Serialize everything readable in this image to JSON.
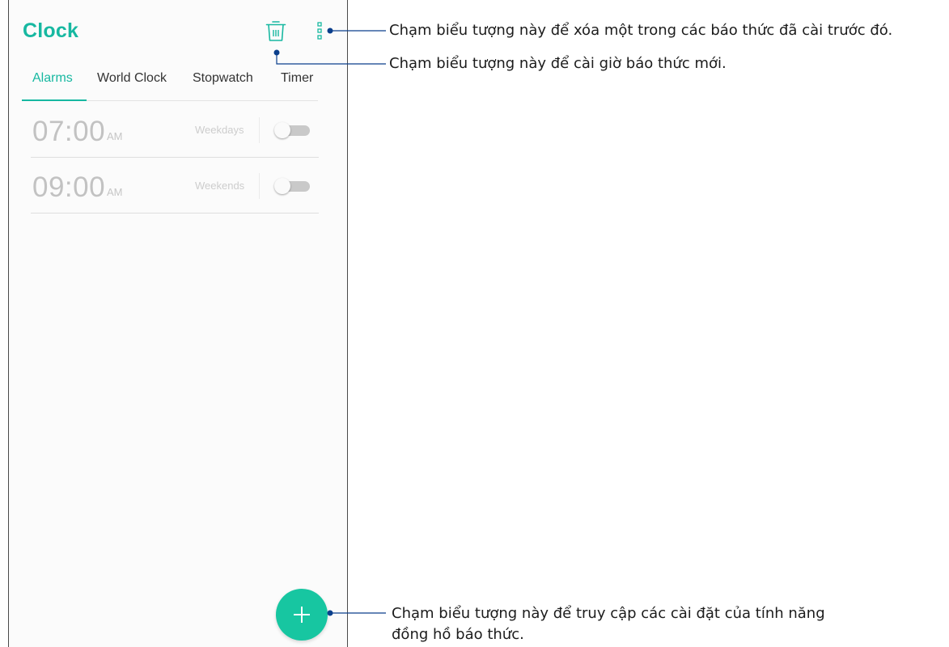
{
  "app": {
    "title": "Clock",
    "accent_color": "#17b8a1",
    "icons": {
      "delete": "trash-icon",
      "menu": "overflow-menu-icon",
      "add": "plus-icon"
    }
  },
  "tabs": [
    {
      "label": "Alarms",
      "active": true
    },
    {
      "label": "World Clock",
      "active": false
    },
    {
      "label": "Stopwatch",
      "active": false
    },
    {
      "label": "Timer",
      "active": false
    }
  ],
  "alarms": [
    {
      "time": "07:00",
      "ampm": "AM",
      "days": "Weekdays",
      "enabled": false
    },
    {
      "time": "09:00",
      "ampm": "AM",
      "days": "Weekends",
      "enabled": false
    }
  ],
  "annotations": {
    "menu_callout": "Chạm biểu tượng này để xóa một trong các báo thức đã cài trước đó.",
    "delete_callout": "Chạm biểu tượng này để cài giờ báo thức mới.",
    "add_callout_line1": "Chạm biểu tượng này để truy cập các cài đặt của tính năng",
    "add_callout_line2": "đồng hồ báo thức."
  }
}
